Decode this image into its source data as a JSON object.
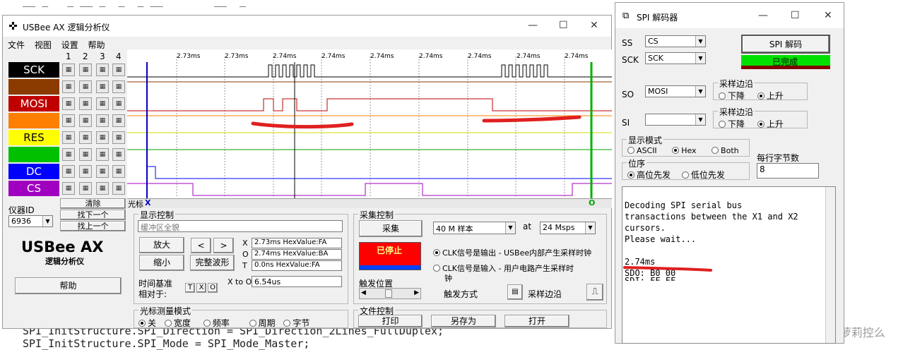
{
  "background_code": {
    "line_top": "__ _   _ __ _  _  _ __        __  _",
    "line1": "SPI_InitStructure.SPI_Direction = SPI_Direction_2Lines_FullDuplex;",
    "line2": "SPI_InitStructure.SPI_Mode = SPI_Mode_Master;"
  },
  "watermark": "CSDN @你是萝莉控么",
  "main": {
    "title": "USBee AX 逻辑分析仪",
    "menu": [
      "文件",
      "视图",
      "设置",
      "帮助"
    ],
    "col_headers": [
      "1",
      "2",
      "3",
      "4"
    ],
    "signals": [
      {
        "label": "SCK",
        "color": "#000000",
        "text": "#ffffff"
      },
      {
        "label": "",
        "color": "#8b3a00",
        "text": "#ffffff"
      },
      {
        "label": "MOSI",
        "color": "#c00000",
        "text": "#ffffff"
      },
      {
        "label": "",
        "color": "#ff7f00",
        "text": "#000000"
      },
      {
        "label": "RES",
        "color": "#ffff00",
        "text": "#000000"
      },
      {
        "label": "",
        "color": "#00c000",
        "text": "#ffffff"
      },
      {
        "label": "DC",
        "color": "#0000ff",
        "text": "#ffffff"
      },
      {
        "label": "CS",
        "color": "#a000c0",
        "text": "#ffffff"
      }
    ],
    "time_labels": [
      "2.73ms",
      "2.73ms",
      "2.74ms",
      "2.74ms",
      "2.74ms",
      "2.74ms",
      "2.74ms",
      "2.74ms",
      "2.74ms",
      "2.74ms",
      "2.74ms"
    ],
    "cursor_bar": {
      "label": "光标",
      "x": "X",
      "o": "O"
    },
    "left": {
      "clear": "清除",
      "device_id_label": "仪器ID",
      "device_id": "6936",
      "find_next": "找下一个",
      "find_prev": "找上一个",
      "logo": "USBee AX",
      "logo_sub": "逻辑分析仪",
      "help": "帮助"
    },
    "display": {
      "title": "显示控制",
      "buffer": "缓冲区全貌",
      "zoom_in": "放大",
      "zoom_out": "缩小",
      "prev": "<",
      "next": ">",
      "full": "完整波形",
      "x_label": "X",
      "x_val": "2.73ms HexValue:FA",
      "o_label": "O",
      "o_val": "2.74ms HexValue:BA",
      "t_label": "T",
      "t_val": "0.0ns HexValue:FA",
      "timebase1": "时间基准",
      "timebase2": "相对于:",
      "t_btn": "T",
      "x_btn": "X",
      "o_btn": "O",
      "xo_label": "X to O",
      "xo_val": "6.54us"
    },
    "cursor_mode": {
      "title": "光标测量模式",
      "options": [
        "关",
        "宽度",
        "频率",
        "周期",
        "字节"
      ],
      "selected": "关"
    },
    "capture": {
      "title": "采集控制",
      "acquire": "采集",
      "samples": "40 M 样本",
      "at": "at",
      "rate": "24 Msps",
      "stopped": "已停止",
      "clk_out": "CLK信号是输出 - USBee内部产生采样时钟",
      "clk_in1": "CLK信号是输入 - 用户电路产生采样时",
      "clk_in2": "钟",
      "trigger_pos": "触发位置",
      "trigger_mode": "触发方式",
      "sample_edge": "采样边沿"
    },
    "file": {
      "title": "文件控制",
      "print": "打印",
      "save": "另存为",
      "open": "打开"
    }
  },
  "spi": {
    "title": "SPI 解码器",
    "ss_label": "SS",
    "ss_val": "CS",
    "sck_label": "SCK",
    "sck_val": "SCK",
    "decode_btn": "SPI 解码",
    "done": "已完成",
    "so_label": "SO",
    "so_val": "MOSI",
    "si_label": "SI",
    "si_val": "",
    "edge_title": "采样边沿",
    "fall": "下降",
    "rise": "上升",
    "display_title": "显示模式",
    "ascii": "ASCII",
    "hex": "Hex",
    "both": "Both",
    "bit_order_title": "位序",
    "msb": "高位先发",
    "lsb": "低位先发",
    "bytes_label": "每行字节数",
    "bytes_val": "8",
    "output": [
      "Decoding SPI serial bus",
      "transactions between the X1 and X2",
      "cursors.",
      "Please wait...",
      "",
      "2.74ms",
      "SDO: B0 00",
      "SDI: FF FF"
    ]
  }
}
